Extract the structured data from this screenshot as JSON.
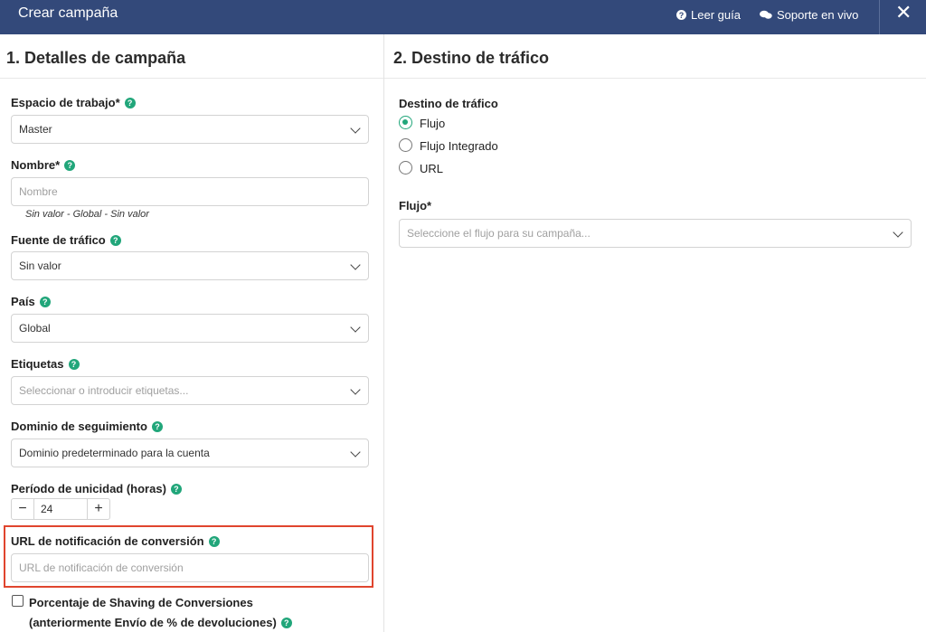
{
  "header": {
    "title": "Crear campaña",
    "guide_label": "Leer guía",
    "support_label": "Soporte en vivo",
    "close_symbol": "✕"
  },
  "left": {
    "section_title": "1. Detalles de campaña",
    "workspace": {
      "label": "Espacio de trabajo*",
      "value": "Master"
    },
    "name": {
      "label": "Nombre*",
      "placeholder": "Nombre",
      "hint": "Sin valor - Global - Sin valor"
    },
    "traffic_source": {
      "label": "Fuente de tráfico",
      "value": "Sin valor"
    },
    "country": {
      "label": "País",
      "value": "Global"
    },
    "tags": {
      "label": "Etiquetas",
      "placeholder": "Seleccionar o introducir etiquetas..."
    },
    "tracking_domain": {
      "label": "Dominio de seguimiento",
      "value": "Dominio predeterminado para la cuenta"
    },
    "uniqueness": {
      "label": "Período de unicidad (horas)",
      "value": "24",
      "minus": "−",
      "plus": "+"
    },
    "postback": {
      "label": "URL de notificación de conversión",
      "placeholder": "URL de notificación de conversión"
    },
    "shaving": {
      "label_line1": "Porcentaje de Shaving de Conversiones",
      "label_line2": "(anteriormente Envío de % de devoluciones)"
    }
  },
  "right": {
    "section_title": "2. Destino de tráfico",
    "destination": {
      "label": "Destino de tráfico",
      "options": [
        "Flujo",
        "Flujo Integrado",
        "URL"
      ],
      "selected": "Flujo"
    },
    "flow": {
      "label": "Flujo*",
      "placeholder": "Seleccione el flujo para su campaña..."
    }
  },
  "colors": {
    "header_bg": "#33497a",
    "accent": "#21a67a",
    "highlight": "#e0452e"
  },
  "icons": {
    "help": "question-circle-icon",
    "guide": "question-circle-icon",
    "support": "chat-bubbles-icon",
    "close": "close-icon"
  }
}
